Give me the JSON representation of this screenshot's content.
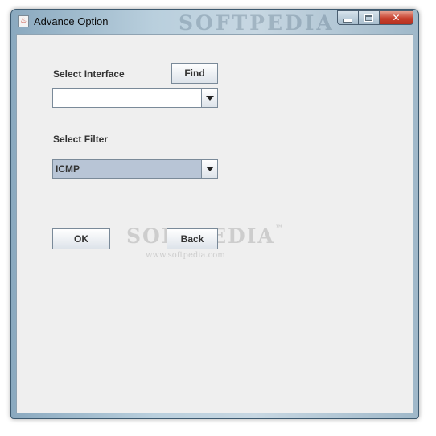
{
  "window": {
    "title": "Advance Option",
    "app_icon_glyph": "♨",
    "watermark": "SOFTPEDIA",
    "controls": {
      "minimize_icon": "minimize-icon",
      "maximize_icon": "maximize-icon",
      "close_glyph": "✕"
    }
  },
  "form": {
    "interface_label": "Select Interface",
    "find_label": "Find",
    "interface_value": "",
    "filter_label": "Select Filter",
    "filter_value": "ICMP",
    "ok_label": "OK",
    "back_label": "Back"
  },
  "watermark": {
    "main": "SOFTPEDIA",
    "url": "www.softpedia.com",
    "mark": "™"
  },
  "colors": {
    "client_bg": "#efefef",
    "filter_combo_bg": "#b8c5d6",
    "interface_combo_bg": "#ffffff",
    "close_button": "#c7402d"
  }
}
